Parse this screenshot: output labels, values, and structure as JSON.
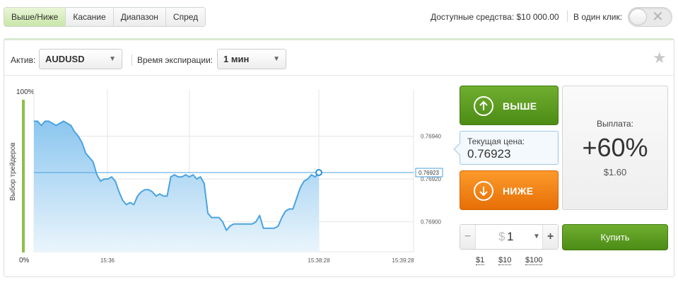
{
  "tabs": [
    {
      "label": "Выше/Ниже",
      "active": true
    },
    {
      "label": "Касание",
      "active": false
    },
    {
      "label": "Диапазон",
      "active": false
    },
    {
      "label": "Спред",
      "active": false
    }
  ],
  "header": {
    "funds": "Доступные средства: $10 000.00",
    "oneclick_label": "В один клик:",
    "toggle_state": "off"
  },
  "controls": {
    "asset_label": "Актив:",
    "asset_value": "AUDUSD",
    "expiry_label": "Время экспирации:",
    "expiry_value": "1 мин"
  },
  "trader_choice": {
    "label": "Выбор трейдеров",
    "top": "100%",
    "bottom": "0%",
    "level": 1.0
  },
  "chart_data": {
    "type": "area",
    "y_labels": [
      "0.76940",
      "0.76920",
      "0.76900"
    ],
    "y_ticks": [
      0.7694,
      0.7692,
      0.769
    ],
    "current_label": "0.76923",
    "current_value": 0.76923,
    "x_labels": [
      "15:36",
      "15:38:28",
      "15:39:28"
    ],
    "ylim": [
      0.76886,
      0.76962
    ],
    "values": [
      0.76947,
      0.76947,
      0.76945,
      0.76947,
      0.76947,
      0.76946,
      0.76945,
      0.76946,
      0.76947,
      0.76946,
      0.76945,
      0.76942,
      0.7694,
      0.76937,
      0.76932,
      0.7693,
      0.76928,
      0.76922,
      0.76919,
      0.7692,
      0.7692,
      0.76921,
      0.76919,
      0.76914,
      0.7691,
      0.76908,
      0.76909,
      0.76908,
      0.76912,
      0.76914,
      0.76915,
      0.76915,
      0.76914,
      0.76912,
      0.76913,
      0.76912,
      0.76912,
      0.76921,
      0.76922,
      0.76921,
      0.76921,
      0.76922,
      0.76921,
      0.76922,
      0.7692,
      0.76921,
      0.76918,
      0.76904,
      0.76902,
      0.76902,
      0.76902,
      0.769,
      0.76896,
      0.76898,
      0.76899,
      0.76899,
      0.76899,
      0.76899,
      0.76899,
      0.76899,
      0.769,
      0.76903,
      0.76897,
      0.76897,
      0.76897,
      0.76897,
      0.76898,
      0.76902,
      0.76905,
      0.76906,
      0.76906,
      0.76911,
      0.76916,
      0.76919,
      0.7692,
      0.76922,
      0.76921,
      0.76923
    ],
    "grid": true,
    "colors": {
      "line": "#4aa3e0",
      "fill_top": "#8cc6ef",
      "fill_bottom": "#eaf5fc"
    }
  },
  "up_button": {
    "label": "ВЫШЕ",
    "color": "#5a9c1f",
    "icon": "arrow-up-icon"
  },
  "down_button": {
    "label": "НИЖЕ",
    "color": "#f07c12",
    "icon": "arrow-down-icon"
  },
  "current_price": {
    "label": "Текущая цена:",
    "value": "0.76923"
  },
  "payout": {
    "label": "Выплата:",
    "percent": "+60%",
    "amount": "$1.60"
  },
  "amount": {
    "currency": "$",
    "value": "1",
    "minus": "−",
    "plus": "+"
  },
  "buy_button": {
    "label": "Купить"
  },
  "quick_amounts": [
    "$1",
    "$10",
    "$100"
  ]
}
